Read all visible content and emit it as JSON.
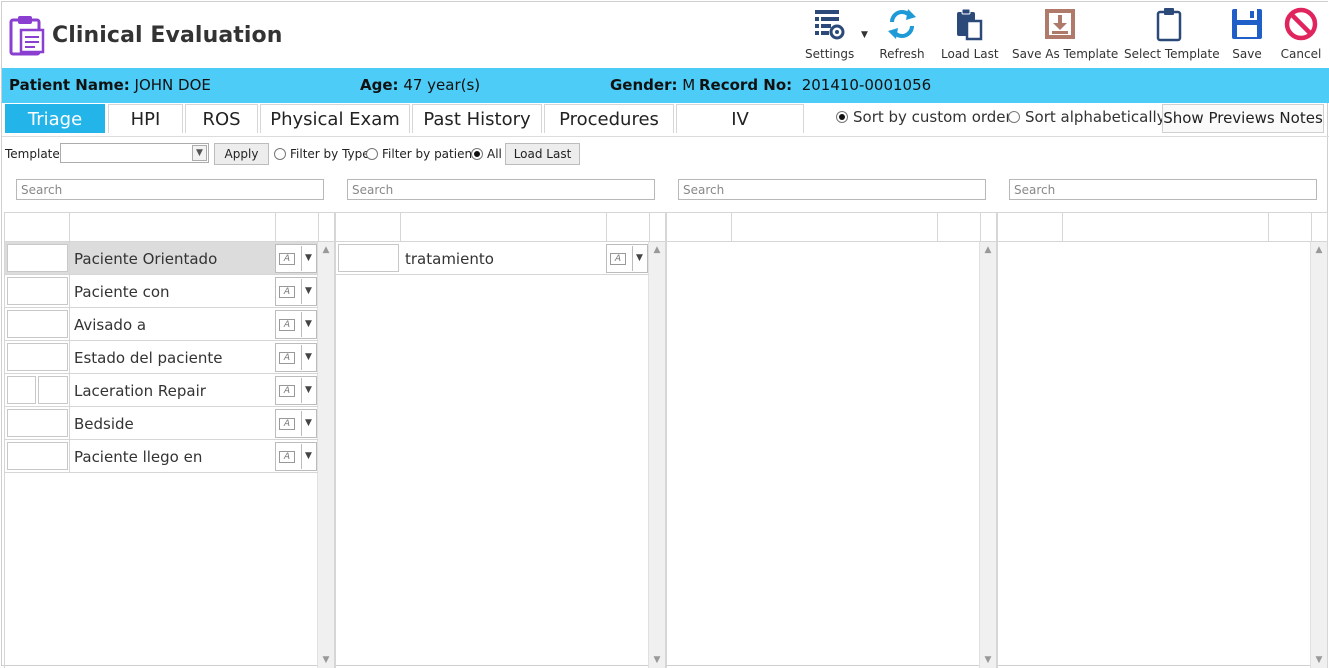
{
  "app": {
    "title": "Clinical Evaluation"
  },
  "toolbar": {
    "settings_label": "Settings",
    "refresh_label": "Refresh",
    "load_last_label": "Load Last",
    "save_as_template_label": "Save As Template",
    "select_template_label": "Select Template",
    "save_label": "Save",
    "cancel_label": "Cancel",
    "icons": {
      "settings": "settings-icon",
      "refresh": "refresh-icon",
      "load_last": "clipboard-paste-icon",
      "save_as_template": "download-box-icon",
      "select_template": "clipboard-icon",
      "save": "floppy-disk-icon",
      "cancel": "prohibited-icon"
    },
    "colors": {
      "settings": "#2b4a7a",
      "refresh": "#1e9ad6",
      "load_last": "#2b4a7a",
      "save_as_template": "#b07a6b",
      "select_template": "#2b4a7a",
      "save": "#1f5fc7",
      "cancel": "#e0245e"
    }
  },
  "patient": {
    "name_label": "Patient Name:",
    "name_value": "JOHN DOE",
    "age_label": "Age:",
    "age_value": "47 year(s)",
    "gender_label": "Gender:",
    "gender_value": "M",
    "record_label": "Record No:",
    "record_value": "201410-0001056"
  },
  "tabs": [
    {
      "label": "Triage",
      "active": true
    },
    {
      "label": "HPI"
    },
    {
      "label": "ROS"
    },
    {
      "label": "Physical Exam"
    },
    {
      "label": "Past History"
    },
    {
      "label": "Procedures"
    },
    {
      "label": "IV"
    }
  ],
  "sort": {
    "custom_label": "Sort by custom order",
    "alpha_label": "Sort alphabetically",
    "selected": "custom"
  },
  "show_notes_label": "Show Previews Notes",
  "templates": {
    "label": "Templates",
    "selected_value": "",
    "apply_label": "Apply",
    "filter_type_label": "Filter by Type",
    "filter_patient_label": "Filter by patient",
    "all_label": "All",
    "filter_selected": "all",
    "load_last_label": "Load Last"
  },
  "search": {
    "placeholder": "Search"
  },
  "panels": [
    {
      "items": [
        {
          "label": "Paciente Orientado",
          "selected": true
        },
        {
          "label": "Paciente con"
        },
        {
          "label": "Avisado a"
        },
        {
          "label": "Estado del paciente"
        },
        {
          "label": "Laceration Repair",
          "split": true
        },
        {
          "label": "Bedside"
        },
        {
          "label": "Paciente llego en"
        }
      ]
    },
    {
      "items": [
        {
          "label": "tratamiento"
        }
      ]
    },
    {
      "items": []
    },
    {
      "items": []
    }
  ],
  "colors": {
    "patient_bar": "#4dccf7",
    "active_tab": "#23b5ea",
    "app_icon": "#8a3fd1"
  }
}
